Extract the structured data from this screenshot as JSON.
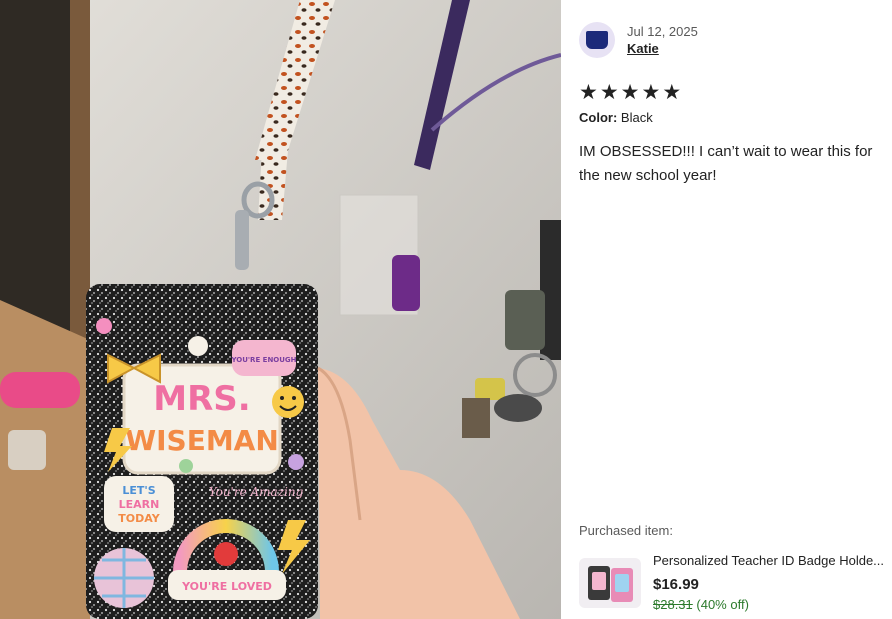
{
  "review": {
    "date": "Jul 12, 2025",
    "reviewer_name": "Katie",
    "rating": 5,
    "stars": [
      "★",
      "★",
      "★",
      "★",
      "★"
    ],
    "variation_label": "Color:",
    "variation_value": "Black",
    "text": "IM OBSESSED!!! I can’t wait to wear this for the new school year!"
  },
  "purchased": {
    "label": "Purchased item:",
    "title": "Personalized Teacher ID Badge Holde...",
    "price": "$16.99",
    "original_price": "$28.31",
    "discount": "(40% off)"
  },
  "photo": {
    "badge_name_line1": "MRS.",
    "badge_name_line2": "WISEMAN",
    "sticker_enough": "YOU'RE ENOUGH",
    "sticker_learn_1": "LET'S",
    "sticker_learn_2": "LEARN",
    "sticker_learn_3": "TODAY",
    "sticker_amazing": "You're Amazing",
    "sticker_loved": "YOU'RE LOVED"
  },
  "colors": {
    "stars": "#222222",
    "discount_green": "#2c7a2c",
    "avatar_bg": "#e7e2f4"
  }
}
